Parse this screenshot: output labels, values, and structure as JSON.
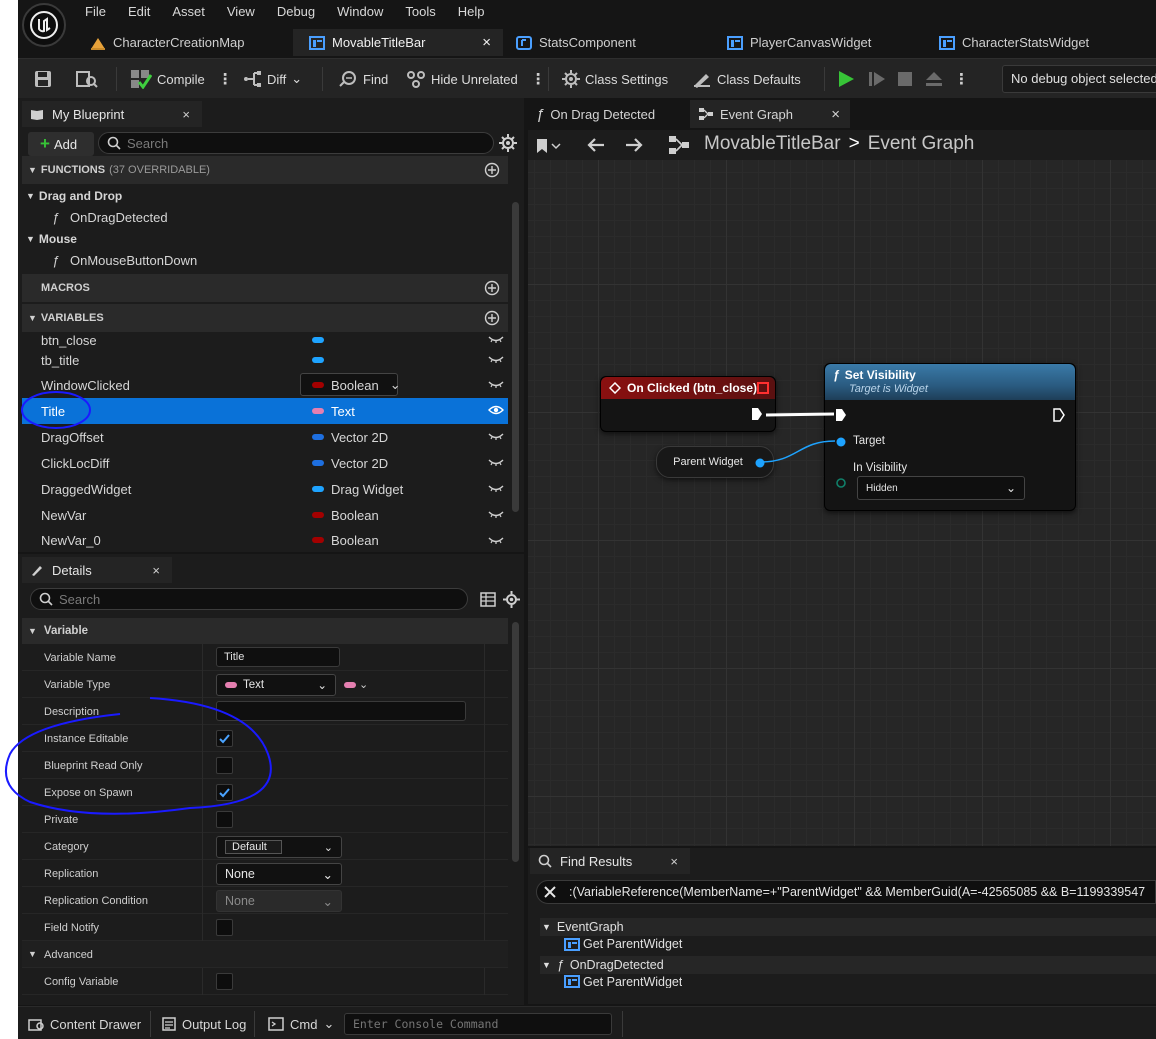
{
  "menu": [
    "File",
    "Edit",
    "Asset",
    "View",
    "Debug",
    "Window",
    "Tools",
    "Help"
  ],
  "tabs": [
    {
      "label": "CharacterCreationMap",
      "icon": "level-icon"
    },
    {
      "label": "MovableTitleBar",
      "icon": "widget-blueprint-icon",
      "active": true,
      "close": "×"
    },
    {
      "label": "StatsComponent",
      "icon": "component-blueprint-icon"
    },
    {
      "label": "PlayerCanvasWidget",
      "icon": "widget-blueprint-icon"
    },
    {
      "label": "CharacterStatsWidget",
      "icon": "widget-blueprint-icon"
    }
  ],
  "toolbar": {
    "compile": "Compile",
    "diff": "Diff",
    "find": "Find",
    "hide_unrelated": "Hide Unrelated",
    "class_settings": "Class Settings",
    "class_defaults": "Class Defaults",
    "debug_object": "No debug object selected"
  },
  "my_blueprint": {
    "title": "My Blueprint",
    "close": "×",
    "add": "Add",
    "search_placeholder": "Search",
    "functions_header": "FUNCTIONS",
    "functions_count": "(37 OVERRIDABLE)",
    "categories": [
      {
        "name": "Drag and Drop",
        "items": [
          "OnDragDetected"
        ]
      },
      {
        "name": "Mouse",
        "items": [
          "OnMouseButtonDown"
        ]
      }
    ],
    "macros_header": "MACROS",
    "variables_header": "VARIABLES",
    "variables": [
      {
        "name": "btn_close",
        "type": "",
        "color": "#1ea3ff"
      },
      {
        "name": "tb_title",
        "type": "",
        "color": "#1ea3ff"
      },
      {
        "name": "WindowClicked",
        "type": "Boolean",
        "color": "#a30000",
        "dropdown": true
      },
      {
        "name": "Title",
        "type": "Text",
        "color": "#e57fb0",
        "selected": true
      },
      {
        "name": "DragOffset",
        "type": "Vector 2D",
        "color": "#1e6fe0"
      },
      {
        "name": "ClickLocDiff",
        "type": "Vector 2D",
        "color": "#1e6fe0"
      },
      {
        "name": "DraggedWidget",
        "type": "Drag Widget",
        "color": "#1ea3ff"
      },
      {
        "name": "NewVar",
        "type": "Boolean",
        "color": "#a30000"
      },
      {
        "name": "NewVar_0",
        "type": "Boolean",
        "color": "#a30000"
      }
    ]
  },
  "details": {
    "title": "Details",
    "close": "×",
    "search_placeholder": "Search",
    "section_variable": "Variable",
    "rows": {
      "variable_name": {
        "label": "Variable Name",
        "value": "Title"
      },
      "variable_type": {
        "label": "Variable Type",
        "value": "Text"
      },
      "description": {
        "label": "Description",
        "value": ""
      },
      "instance_editable": {
        "label": "Instance Editable",
        "checked": true
      },
      "blueprint_read_only": {
        "label": "Blueprint Read Only",
        "checked": false
      },
      "expose_on_spawn": {
        "label": "Expose on Spawn",
        "checked": true
      },
      "private": {
        "label": "Private",
        "checked": false
      },
      "category": {
        "label": "Category",
        "value": "Default"
      },
      "replication": {
        "label": "Replication",
        "value": "None"
      },
      "replication_condition": {
        "label": "Replication Condition",
        "value": "None"
      },
      "field_notify": {
        "label": "Field Notify",
        "checked": false
      }
    },
    "section_advanced": "Advanced",
    "config_variable": {
      "label": "Config Variable",
      "checked": false
    }
  },
  "graph": {
    "tabs": [
      {
        "label": "On Drag Detected"
      },
      {
        "label": "Event Graph",
        "close": "×"
      }
    ],
    "breadcrumb": {
      "root": "MovableTitleBar",
      "sep": ">",
      "current": "Event Graph"
    },
    "nodes": {
      "event": {
        "title": "On Clicked (btn_close)"
      },
      "parent": {
        "title": "Parent Widget"
      },
      "set_vis": {
        "title": "Set Visibility",
        "subtitle": "Target is Widget",
        "target": "Target",
        "in_vis": "In Visibility",
        "value": "Hidden"
      }
    }
  },
  "find_results": {
    "title": "Find Results",
    "close": "×",
    "query": ":(VariableReference(MemberName=+\"ParentWidget\" && MemberGuid(A=-42565085 && B=1199339547",
    "groups": [
      {
        "name": "EventGraph",
        "items": [
          "Get ParentWidget"
        ]
      },
      {
        "name": "OnDragDetected",
        "items": [
          "Get ParentWidget"
        ]
      }
    ]
  },
  "statusbar": {
    "content_drawer": "Content Drawer",
    "output_log": "Output Log",
    "cmd": "Cmd",
    "console_placeholder": "Enter Console Command"
  },
  "colors": {
    "accent": "#0a72d8",
    "annotation": "#1a1aff",
    "exec_node": "#8a1010",
    "func_node": "#2a5b80"
  }
}
